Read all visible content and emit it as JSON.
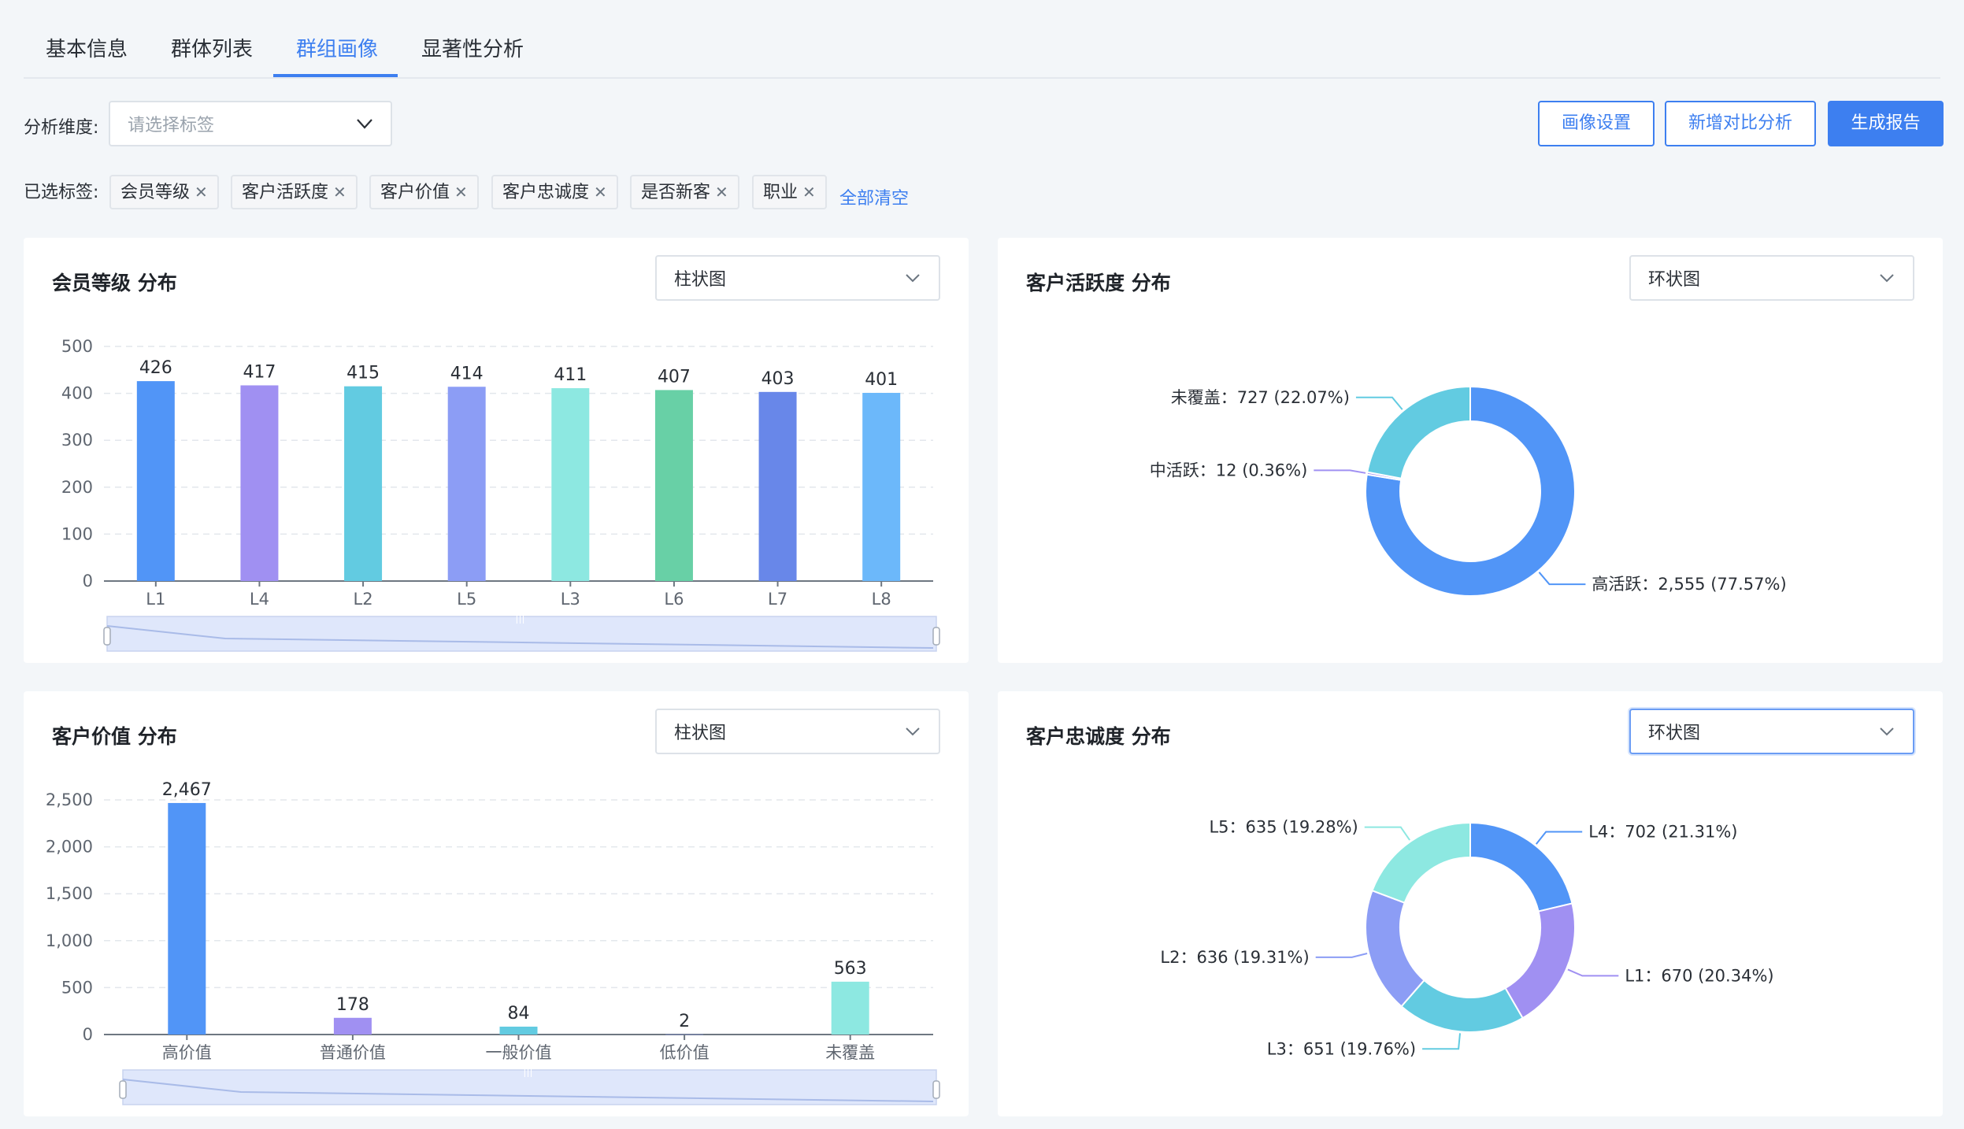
{
  "tabs": [
    {
      "label": "基本信息"
    },
    {
      "label": "群体列表"
    },
    {
      "label": "群组画像"
    },
    {
      "label": "显著性分析"
    }
  ],
  "active_tab": "群组画像",
  "filters": {
    "dimension_label": "分析维度:",
    "dimension_placeholder": "请选择标签",
    "selected_label": "已选标签:",
    "selected_tags": [
      "会员等级",
      "客户活跃度",
      "客户价值",
      "客户忠诚度",
      "是否新客",
      "职业"
    ],
    "clear_all": "全部清空"
  },
  "actions": {
    "portrait_settings": "画像设置",
    "add_compare": "新增对比分析",
    "generate_report": "生成报告"
  },
  "colors": {
    "accent": "#3d7ff0",
    "palette": [
      "#5195f7",
      "#a090f2",
      "#62cbe1",
      "#8c9df5",
      "#8de8e1",
      "#68d0a6",
      "#6887e9",
      "#6cb8fa"
    ]
  },
  "cards": [
    {
      "title": "会员等级 分布",
      "chart_type_label": "柱状图"
    },
    {
      "title": "客户活跃度 分布",
      "chart_type_label": "环状图"
    },
    {
      "title": "客户价值 分布",
      "chart_type_label": "柱状图"
    },
    {
      "title": "客户忠诚度 分布",
      "chart_type_label": "环状图"
    }
  ],
  "chart_data": [
    {
      "type": "bar",
      "title": "会员等级 分布",
      "categories": [
        "L1",
        "L4",
        "L2",
        "L5",
        "L3",
        "L6",
        "L7",
        "L8"
      ],
      "values": [
        426,
        417,
        415,
        414,
        411,
        407,
        403,
        401
      ],
      "ylim": [
        0,
        500
      ],
      "yticks": [
        "0",
        "100",
        "200",
        "300",
        "400",
        "500"
      ],
      "grid": true,
      "zoom_slider": true
    },
    {
      "type": "pie",
      "title": "客户活跃度 分布",
      "donut": true,
      "slices": [
        {
          "label": "高活跃",
          "value": 2555,
          "text": "高活跃：2,555 (77.57%)",
          "color": "#5195f7"
        },
        {
          "label": "中活跃",
          "value": 12,
          "text": "中活跃：12 (0.36%)",
          "color": "#a090f2"
        },
        {
          "label": "未覆盖",
          "value": 727,
          "text": "未覆盖：727 (22.07%)",
          "color": "#62cbe1"
        }
      ]
    },
    {
      "type": "bar",
      "title": "客户价值 分布",
      "categories": [
        "高价值",
        "普通价值",
        "一般价值",
        "低价值",
        "未覆盖"
      ],
      "values": [
        2467,
        178,
        84,
        2,
        563
      ],
      "value_labels": [
        "2,467",
        "178",
        "84",
        "2",
        "563"
      ],
      "ylim": [
        0,
        2500
      ],
      "yticks": [
        "0",
        "500",
        "1,000",
        "1,500",
        "2,000",
        "2,500"
      ],
      "grid": true,
      "zoom_slider": true
    },
    {
      "type": "pie",
      "title": "客户忠诚度 分布",
      "donut": true,
      "slices": [
        {
          "label": "L4",
          "value": 702,
          "text": "L4：702 (21.31%)",
          "color": "#5195f7"
        },
        {
          "label": "L1",
          "value": 670,
          "text": "L1：670 (20.34%)",
          "color": "#a090f2"
        },
        {
          "label": "L3",
          "value": 651,
          "text": "L3：651 (19.76%)",
          "color": "#62cbe1"
        },
        {
          "label": "L2",
          "value": 636,
          "text": "L2：636 (19.31%)",
          "color": "#8c9df5"
        },
        {
          "label": "L5",
          "value": 635,
          "text": "L5：635 (19.28%)",
          "color": "#8de8e1"
        }
      ]
    }
  ]
}
